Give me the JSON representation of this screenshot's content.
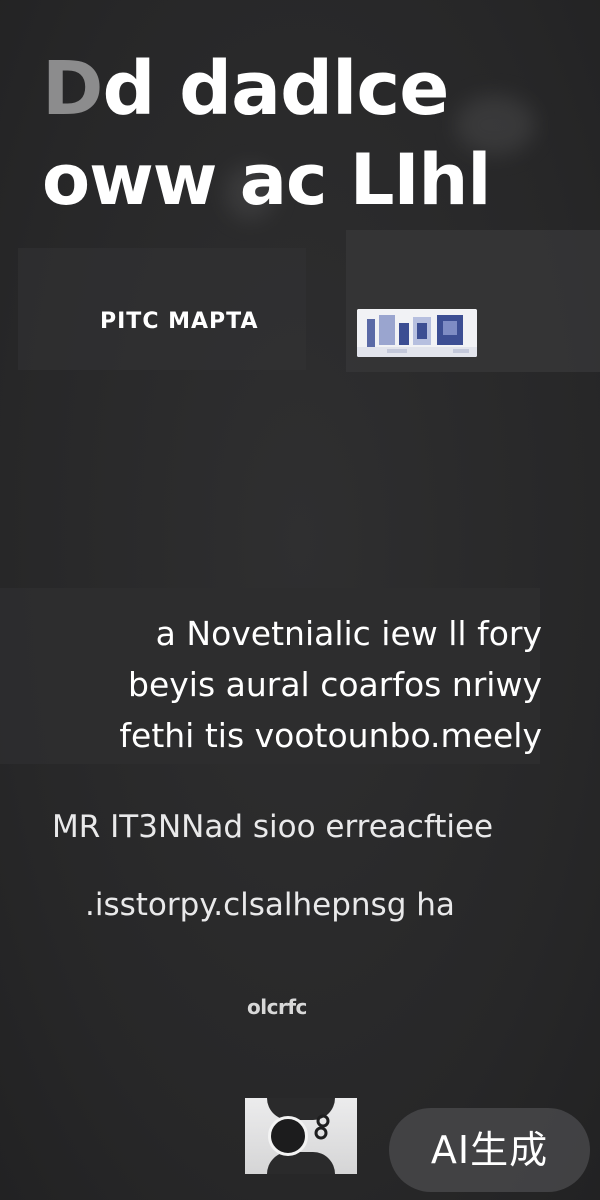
{
  "headline": {
    "line1_lead": "D",
    "line1_rest": "d dadlce",
    "line2": "oww ac LIhl"
  },
  "tagline": "PITC MAPTA",
  "body_text": [
    "a Novetnialic iew ll fory",
    "beyis aural coarfos nriwy",
    "fethi tis vootounbo.meely"
  ],
  "sub_text": [
    "MR IT3NNad sioo erreacftiee",
    ".isstorpy.clsalhepnsg ha"
  ],
  "small_logo": "olcrfc",
  "ai_badge": "AI生成",
  "colors": {
    "background": "#2a2a2b",
    "text": "#ffffff",
    "headline_lead": "#8c8c8d",
    "badge": "#444446",
    "thumb_accent": "#3c4e93"
  },
  "icons": {
    "play_button": "play-circle-icon",
    "camera": "camera-icon"
  }
}
